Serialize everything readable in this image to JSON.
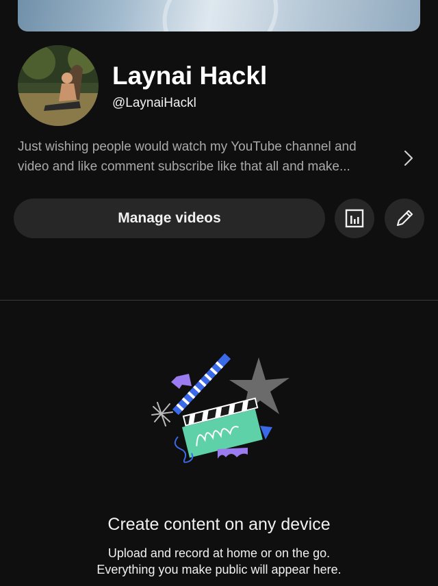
{
  "channel": {
    "name": "Laynai Hackl",
    "handle": "@LaynaiHackl",
    "description_line1": "Just wishing people would watch my YouTube channel and",
    "description_line2": "video and like comment subscribe like that all and make..."
  },
  "actions": {
    "manage_videos_label": "Manage videos",
    "analytics_icon": "analytics-icon",
    "edit_icon": "pencil-icon"
  },
  "empty_state": {
    "title": "Create content on any device",
    "subtitle_line1": "Upload and record at home or on the go.",
    "subtitle_line2": "Everything you make public will appear here."
  },
  "colors": {
    "background": "#0f0f0f",
    "button": "#272727",
    "clapper_green": "#5fd1a8",
    "accent_blue": "#3b6ae8",
    "accent_purple": "#9b7cf0"
  }
}
